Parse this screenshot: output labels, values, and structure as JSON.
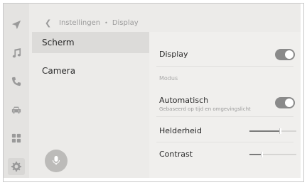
{
  "breadcrumb": {
    "back_icon": "chevron-left-icon",
    "parent": "Instellingen",
    "separator": "•",
    "current": "Display"
  },
  "rail": {
    "icons": [
      "navigation-icon",
      "music-icon",
      "phone-icon",
      "car-icon",
      "apps-icon",
      "gear-icon"
    ],
    "active_index": 5
  },
  "menu": {
    "items": [
      {
        "label": "Scherm",
        "selected": true
      },
      {
        "label": "Camera",
        "selected": false
      }
    ],
    "mic_icon": "microphone-icon"
  },
  "settings": {
    "display": {
      "label": "Display",
      "on": true
    },
    "section_modus": "Modus",
    "automatisch": {
      "label": "Automatisch",
      "sub": "Gebaseerd op tijd en omgevingslicht",
      "on": true
    },
    "helderheid": {
      "label": "Helderheid",
      "value": 0.65
    },
    "contrast": {
      "label": "Contrast",
      "value": 0.25
    }
  },
  "colors": {
    "background": "#ecebe9",
    "panel": "#f0efed",
    "toggle_on": "#8a8a8a",
    "accent_icon": "#9a9a9a"
  }
}
